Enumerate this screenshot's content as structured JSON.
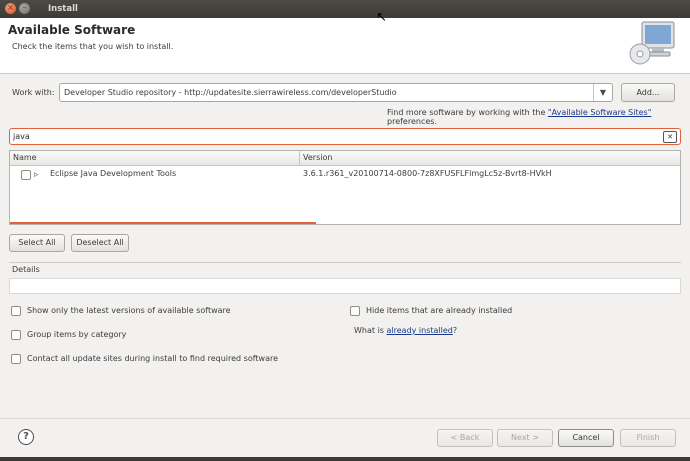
{
  "window": {
    "title": "Install"
  },
  "header": {
    "title": "Available Software",
    "subtitle": "Check the items that you wish to install."
  },
  "work_with": {
    "label": "Work with:",
    "value": "Developer Studio repository - http://updatesite.sierrawireless.com/developerStudio",
    "add_label": "Add..."
  },
  "find_more": {
    "prefix": "Find more software by working with the ",
    "link": "\"Available Software Sites\"",
    "suffix": " preferences."
  },
  "filter": {
    "value": "java"
  },
  "table": {
    "columns": [
      "Name",
      "Version"
    ],
    "rows": [
      {
        "name": "Eclipse Java Development Tools",
        "version": "3.6.1.r361_v20100714-0800-7z8XFUSFLFlmgLc5z-Bvrt8-HVkH",
        "checked": false
      }
    ]
  },
  "buttons": {
    "select_all": "Select All",
    "deselect_all": "Deselect All"
  },
  "details": {
    "label": "Details"
  },
  "options": {
    "latest_versions": "Show only the latest versions of available software",
    "hide_installed": "Hide items that are already installed",
    "group_by_category": "Group items by category",
    "what_is_prefix": "What is ",
    "already_installed_link": "already installed",
    "what_is_suffix": "?",
    "contact_sites": "Contact all update sites during install to find required software"
  },
  "footer": {
    "back": "< Back",
    "next": "Next >",
    "cancel": "Cancel",
    "finish": "Finish"
  },
  "colors": {
    "accent": "#e0623b",
    "link": "#1b3a8c",
    "titlebar": "#3c3b37"
  }
}
